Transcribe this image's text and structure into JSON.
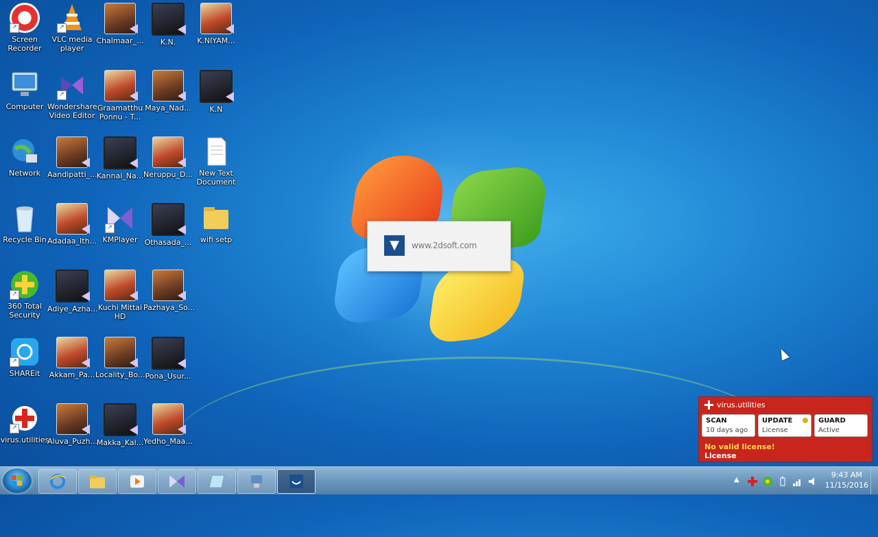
{
  "desktop_icons": [
    {
      "label": "Screen Recorder",
      "col": 0,
      "row": 0,
      "kind": "recorder-icon"
    },
    {
      "label": "VLC media player",
      "col": 1,
      "row": 0,
      "kind": "vlc-icon"
    },
    {
      "label": "Chalmaar_...",
      "col": 2,
      "row": 0,
      "kind": "video-thumbnail-icon"
    },
    {
      "label": "K.N.",
      "col": 3,
      "row": 0,
      "kind": "video-thumbnail-icon"
    },
    {
      "label": "K.NIYAM...",
      "col": 4,
      "row": 0,
      "kind": "video-thumbnail-icon"
    },
    {
      "label": "Computer",
      "col": 0,
      "row": 1,
      "kind": "computer-icon"
    },
    {
      "label": "Wondershare Video Editor",
      "col": 1,
      "row": 1,
      "kind": "wondershare-icon"
    },
    {
      "label": "Graamatthu Ponnu - T...",
      "col": 2,
      "row": 1,
      "kind": "video-thumbnail-icon"
    },
    {
      "label": "Maya_Nad...",
      "col": 3,
      "row": 1,
      "kind": "video-thumbnail-icon"
    },
    {
      "label": "K.N",
      "col": 4,
      "row": 1,
      "kind": "video-thumbnail-icon"
    },
    {
      "label": "Network",
      "col": 0,
      "row": 2,
      "kind": "network-icon"
    },
    {
      "label": "Aandipatti_...",
      "col": 1,
      "row": 2,
      "kind": "video-thumbnail-icon"
    },
    {
      "label": "Kannai_Na...",
      "col": 2,
      "row": 2,
      "kind": "video-thumbnail-icon"
    },
    {
      "label": "Neruppu_D...",
      "col": 3,
      "row": 2,
      "kind": "video-thumbnail-icon"
    },
    {
      "label": "New Text Document",
      "col": 4,
      "row": 2,
      "kind": "text-document-icon"
    },
    {
      "label": "Recycle Bin",
      "col": 0,
      "row": 3,
      "kind": "recycle-bin-icon"
    },
    {
      "label": "Adadaa_Ith...",
      "col": 1,
      "row": 3,
      "kind": "video-thumbnail-icon"
    },
    {
      "label": "KMPlayer",
      "col": 2,
      "row": 3,
      "kind": "kmplayer-icon"
    },
    {
      "label": "Othasada_...",
      "col": 3,
      "row": 3,
      "kind": "video-thumbnail-icon"
    },
    {
      "label": "wifi setp",
      "col": 4,
      "row": 3,
      "kind": "folder-icon"
    },
    {
      "label": "360 Total Security",
      "col": 0,
      "row": 4,
      "kind": "security-360-icon"
    },
    {
      "label": "Adiye_Azha...",
      "col": 1,
      "row": 4,
      "kind": "video-thumbnail-icon"
    },
    {
      "label": "Kuchi Mittai HD",
      "col": 2,
      "row": 4,
      "kind": "video-thumbnail-icon"
    },
    {
      "label": "Pazhaya_So...",
      "col": 3,
      "row": 4,
      "kind": "video-thumbnail-icon"
    },
    {
      "label": "SHAREit",
      "col": 0,
      "row": 5,
      "kind": "shareit-icon"
    },
    {
      "label": "Akkam_Pa...",
      "col": 1,
      "row": 5,
      "kind": "video-thumbnail-icon"
    },
    {
      "label": "Locality_Bo...",
      "col": 2,
      "row": 5,
      "kind": "video-thumbnail-icon"
    },
    {
      "label": "Pona_Usur...",
      "col": 3,
      "row": 5,
      "kind": "video-thumbnail-icon"
    },
    {
      "label": "virus.utilities",
      "col": 0,
      "row": 6,
      "kind": "virus-utilities-icon"
    },
    {
      "label": "Aluva_Puzh...",
      "col": 1,
      "row": 6,
      "kind": "video-thumbnail-icon"
    },
    {
      "label": "Makka_Kal...",
      "col": 2,
      "row": 6,
      "kind": "video-thumbnail-icon"
    },
    {
      "label": "Yedho_Maa...",
      "col": 3,
      "row": 6,
      "kind": "video-thumbnail-icon"
    }
  ],
  "popup": {
    "text": "www.2dsoft.com",
    "icon": "installer-icon"
  },
  "virus_panel": {
    "title": "virus.utilities",
    "buttons": [
      {
        "title": "SCAN",
        "subtitle": "10 days ago"
      },
      {
        "title": "UPDATE",
        "subtitle": "License"
      },
      {
        "title": "GUARD",
        "subtitle": "Active"
      }
    ],
    "warning": "No valid license!",
    "license_link": "License",
    "colors": {
      "panel": "#c8261d",
      "warning": "#ffd94a"
    }
  },
  "taskbar": {
    "pinned": [
      {
        "name": "internet-explorer-icon"
      },
      {
        "name": "file-explorer-icon"
      },
      {
        "name": "media-player-icon"
      },
      {
        "name": "kmplayer-taskbar-icon"
      },
      {
        "name": "notepad-icon"
      },
      {
        "name": "network-setup-icon"
      },
      {
        "name": "installer-taskbar-icon",
        "active": true
      }
    ],
    "clock": {
      "time": "9:43 AM",
      "date": "11/15/2016"
    }
  }
}
